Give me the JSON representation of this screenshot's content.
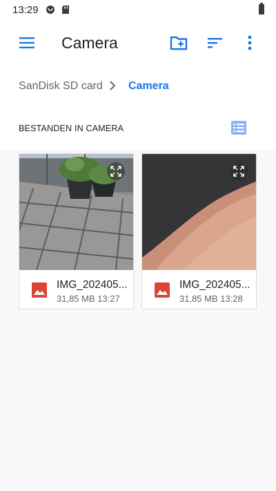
{
  "statusbar": {
    "time": "13:29"
  },
  "appbar": {
    "title": "Camera",
    "accent": "#1a73e8"
  },
  "breadcrumb": {
    "root": "SanDisk SD card",
    "current": "Camera"
  },
  "section": {
    "label": "BESTANDEN IN CAMERA"
  },
  "files": [
    {
      "name": "IMG_202405...",
      "size": "31,85 MB",
      "time": "13:27",
      "icon": "image-file-icon"
    },
    {
      "name": "IMG_202405...",
      "size": "31,85 MB",
      "time": "13:28",
      "icon": "image-file-icon"
    }
  ],
  "colors": {
    "image_icon": "#db4437",
    "accent": "#1a73e8"
  }
}
